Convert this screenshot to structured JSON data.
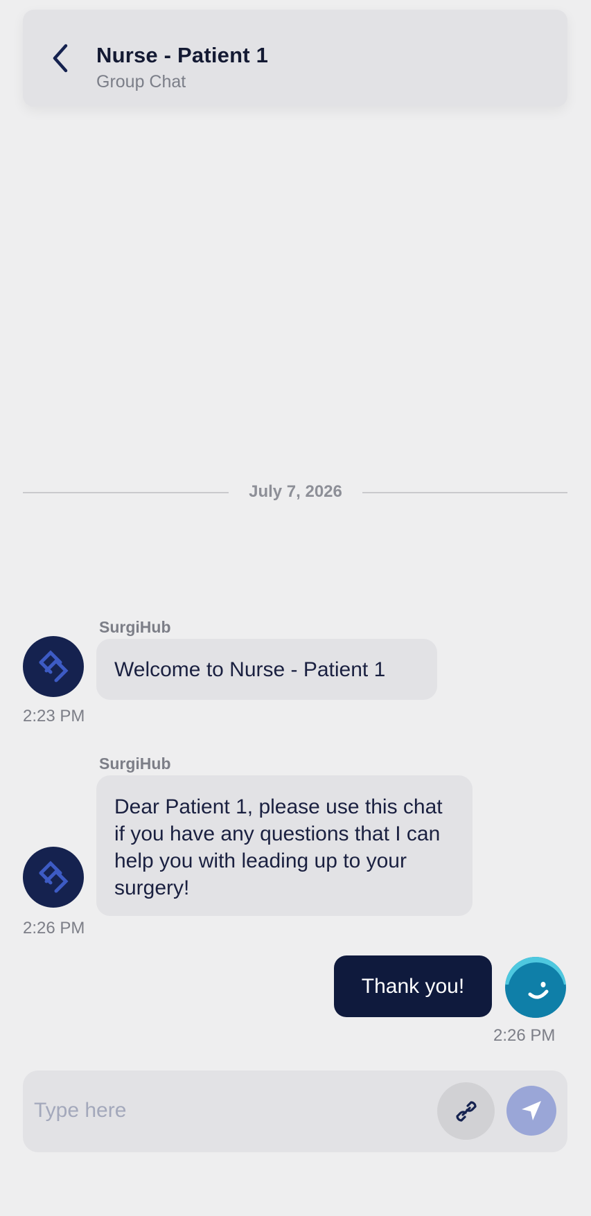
{
  "header": {
    "title": "Nurse - Patient 1",
    "subtitle": "Group Chat",
    "back_icon": "chevron-left-icon"
  },
  "date_divider": {
    "label": "July 7, 2026"
  },
  "messages": [
    {
      "sender": "SurgiHub",
      "text": "Welcome to Nurse - Patient 1",
      "time": "2:23 PM",
      "direction": "incoming"
    },
    {
      "sender": "SurgiHub",
      "text": "Dear Patient 1, please use this chat if you have any questions that I can help you with leading up to your surgery!",
      "time": "2:26 PM",
      "direction": "incoming"
    },
    {
      "sender": "",
      "text": "Thank you!",
      "time": "2:26 PM",
      "direction": "outgoing"
    }
  ],
  "composer": {
    "placeholder": "Type here",
    "value": "",
    "attach_icon": "paperclip-icon",
    "send_icon": "send-arrow-icon"
  },
  "colors": {
    "background": "#eeeeef",
    "surface": "#e2e2e5",
    "outgoing_bubble": "#0f1a3d",
    "bot_avatar": "#15224f",
    "user_avatar": "#0f7fa8",
    "send_button": "#9aa6d7"
  }
}
